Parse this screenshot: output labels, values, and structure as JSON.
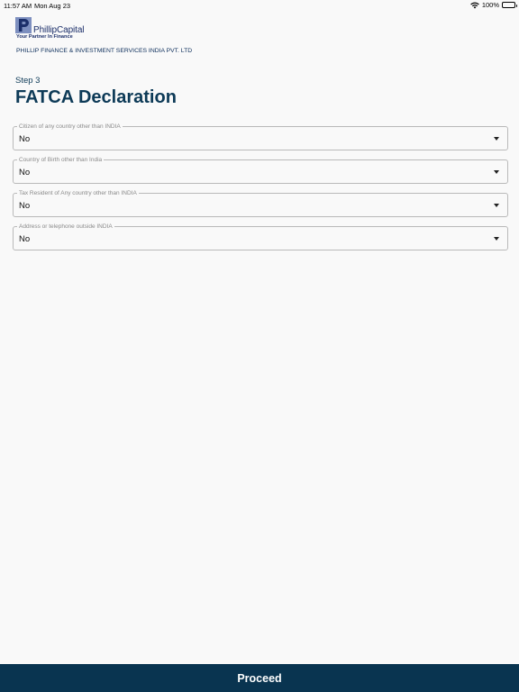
{
  "status_bar": {
    "time": "11:57 AM",
    "date": "Mon Aug 23",
    "battery": "100%"
  },
  "brand": {
    "logo_name": "PhillipCapital",
    "tagline": "Your Partner In Finance",
    "company": "PHILLIP FINANCE & INVESTMENT SERVICES INDIA PVT. LTD",
    "color": "#1c2f6a"
  },
  "header": {
    "step": "Step 3",
    "title": "FATCA Declaration"
  },
  "form": {
    "fields": [
      {
        "label": "Citizen of any country other than INDIA",
        "value": "No"
      },
      {
        "label": "Country of Birth other than India",
        "value": "No"
      },
      {
        "label": "Tax Resident of Any country other than INDIA",
        "value": "No"
      },
      {
        "label": "Address or telephone outside INDIA",
        "value": "No"
      }
    ]
  },
  "footer": {
    "proceed_label": "Proceed",
    "color": "#093450"
  },
  "icons": [
    "wifi-icon",
    "battery-icon",
    "dropdown-arrow-icon"
  ]
}
